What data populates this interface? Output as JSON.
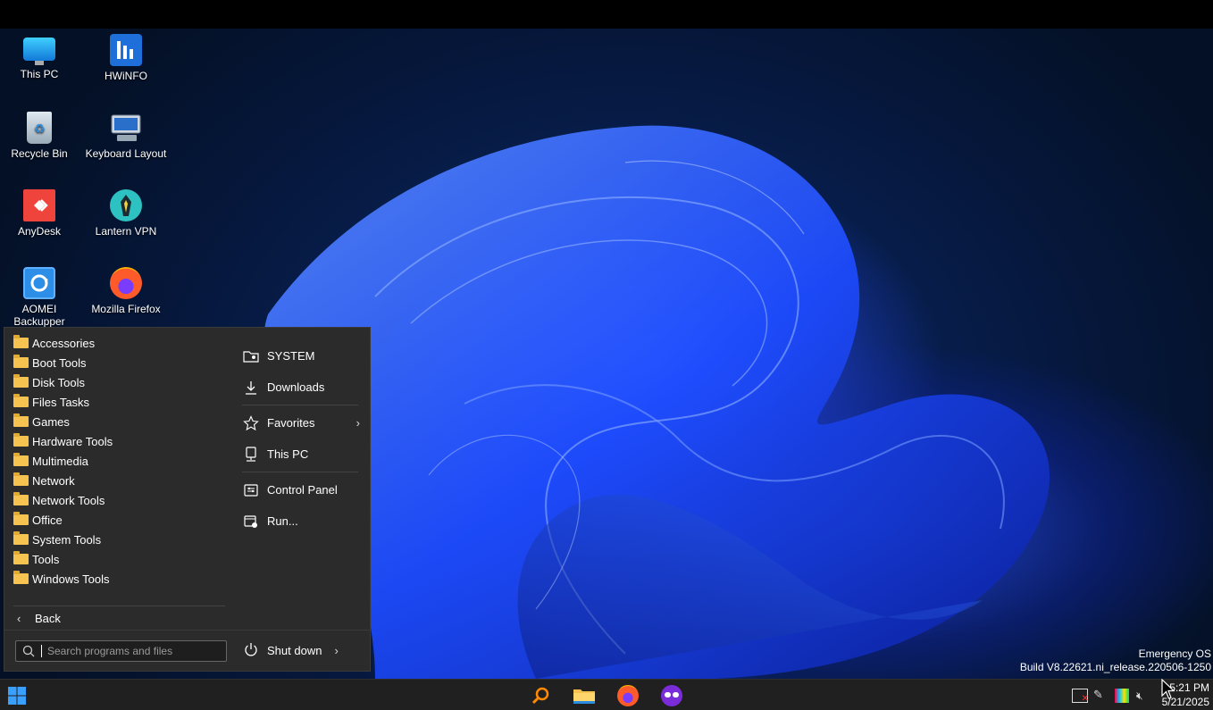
{
  "desktop_icons": [
    {
      "label": "This PC",
      "icon": "monitor-icon"
    },
    {
      "label": "HWiNFO",
      "icon": "hwinfo-icon"
    },
    {
      "label": "Recycle Bin",
      "icon": "recycle-bin-icon"
    },
    {
      "label": "Keyboard Layout",
      "icon": "keyboard-icon"
    },
    {
      "label": "AnyDesk",
      "icon": "anydesk-icon"
    },
    {
      "label": "Lantern VPN",
      "icon": "lantern-icon"
    },
    {
      "label": "AOMEI Backupper",
      "icon": "aomei-icon"
    },
    {
      "label": "Mozilla Firefox",
      "icon": "firefox-icon"
    }
  ],
  "start_menu": {
    "folders": [
      "Accessories",
      "Boot Tools",
      "Disk Tools",
      "Files Tasks",
      "Games",
      "Hardware Tools",
      "Multimedia",
      "Network",
      "Network Tools",
      "Office",
      "System Tools",
      "Tools",
      "Windows Tools"
    ],
    "back_label": "Back",
    "search_placeholder": "Search programs and files",
    "right_items": {
      "system": "SYSTEM",
      "downloads": "Downloads",
      "favorites": "Favorites",
      "this_pc": "This PC",
      "control_panel": "Control Panel",
      "run": "Run..."
    },
    "shutdown_label": "Shut down"
  },
  "build_info": {
    "line1": "Emergency OS",
    "line2": "Build V8.22621.ni_release.220506-1250"
  },
  "taskbar": {
    "time": "5:21 PM",
    "date": "5/21/2025"
  },
  "colors": {
    "menu_bg": "#2b2b2b",
    "taskbar_bg": "#202020",
    "folder_yellow": "#f6c350",
    "accent_blue": "#1a5cff"
  }
}
